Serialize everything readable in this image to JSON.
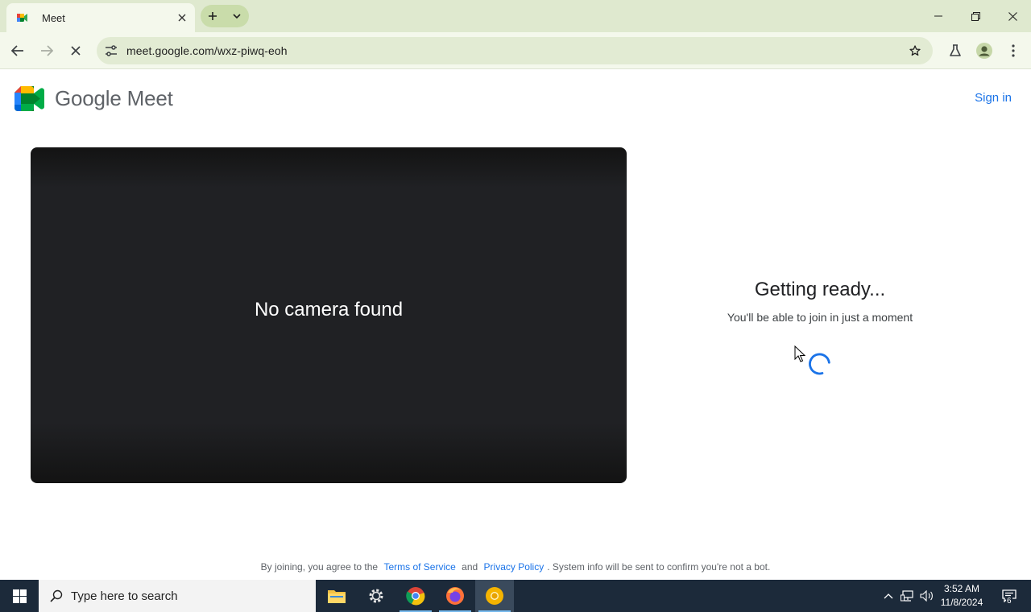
{
  "browser": {
    "tab_title": "Meet",
    "url": "meet.google.com/wxz-piwq-eoh"
  },
  "header": {
    "logo_text": "Google Meet",
    "sign_in": "Sign in"
  },
  "preview": {
    "message": "No camera found"
  },
  "status": {
    "title": "Getting ready...",
    "subtitle": "You'll be able to join in just a moment"
  },
  "footer": {
    "prefix": "By joining, you agree to the",
    "terms": "Terms of Service",
    "and": "and",
    "privacy": "Privacy Policy",
    "suffix": ". System info will be sent to confirm you're not a bot."
  },
  "taskbar": {
    "search_placeholder": "Type here to search",
    "time": "3:52 AM",
    "date": "11/8/2024",
    "notification_count": "6"
  },
  "colors": {
    "accent": "#1a73e8",
    "tabstrip": "#dfe9cf",
    "toolbar": "#f4f8ec",
    "preview_bg": "#202124",
    "taskbar": "#1c2a3a"
  }
}
